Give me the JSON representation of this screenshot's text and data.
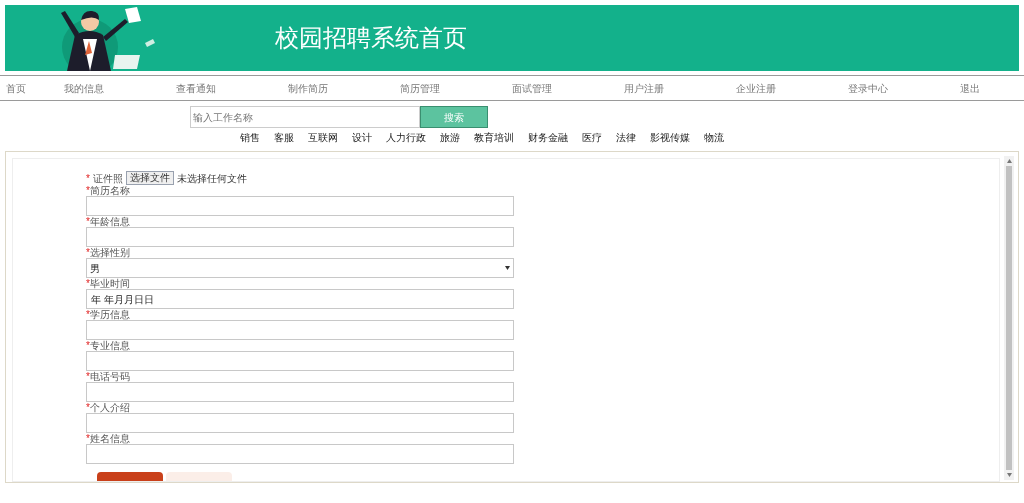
{
  "header": {
    "title": "校园招聘系统首页"
  },
  "nav": [
    {
      "label": "首页"
    },
    {
      "label": "我的信息"
    },
    {
      "label": "查看通知"
    },
    {
      "label": "制作简历"
    },
    {
      "label": "简历管理"
    },
    {
      "label": "面试管理"
    },
    {
      "label": "用户注册"
    },
    {
      "label": "企业注册"
    },
    {
      "label": "登录中心"
    },
    {
      "label": "退出"
    }
  ],
  "search": {
    "placeholder": "输入工作名称",
    "button": "搜索"
  },
  "categories": [
    "销售",
    "客服",
    "互联网",
    "设计",
    "人力行政",
    "旅游",
    "教育培训",
    "财务金融",
    "医疗",
    "法律",
    "影视传媒",
    "物流"
  ],
  "form": {
    "required_mark": "*",
    "fields": [
      {
        "kind": "file",
        "label": "证件照",
        "required": true,
        "button": "选择文件",
        "status": "未选择任何文件"
      },
      {
        "kind": "text",
        "label": "简历名称",
        "required": true
      },
      {
        "kind": "text",
        "label": "年龄信息",
        "required": true
      },
      {
        "kind": "select",
        "label": "选择性别",
        "required": true,
        "value": "男"
      },
      {
        "kind": "date",
        "label": "毕业时间",
        "required": true,
        "value": "年 年月月日日"
      },
      {
        "kind": "text",
        "label": "学历信息",
        "required": true
      },
      {
        "kind": "text",
        "label": "专业信息",
        "required": true
      },
      {
        "kind": "text",
        "label": "电话号码",
        "required": true
      },
      {
        "kind": "text",
        "label": "个人介绍",
        "required": true
      },
      {
        "kind": "text",
        "label": "姓名信息",
        "required": true
      }
    ],
    "buttons": [
      {
        "kind": "primary"
      },
      {
        "kind": "secondary"
      }
    ]
  }
}
